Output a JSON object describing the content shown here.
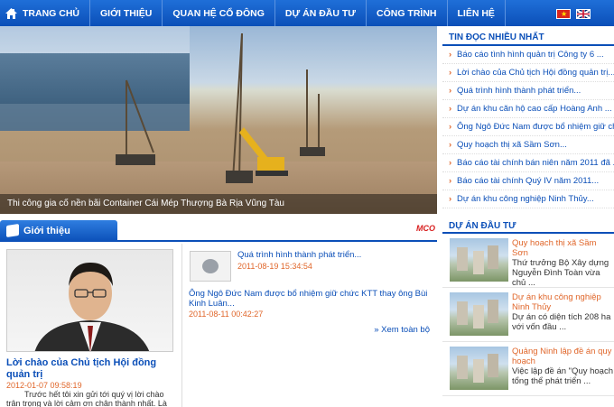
{
  "nav": {
    "items": [
      {
        "label": "TRANG CHỦ"
      },
      {
        "label": "GIỚI THIỆU"
      },
      {
        "label": "QUAN HỆ CỔ ĐÔNG"
      },
      {
        "label": "DỰ ÁN ĐẦU TƯ"
      },
      {
        "label": "CÔNG TRÌNH"
      },
      {
        "label": "LIÊN HỆ"
      }
    ],
    "languages": [
      "vi",
      "en"
    ]
  },
  "hero": {
    "caption": "Thi công gia cố nền bãi Container Cái Mép Thượng Bà Rịa Vũng Tàu"
  },
  "most_read": {
    "title": "TIN ĐỌC NHIỀU NHẤT",
    "items": [
      "Báo cáo tình hình quản trị Công ty 6 ...",
      "Lời chào của Chủ tịch Hội đồng quản trị...",
      "Quá trình hình thành phát triển...",
      "Dự án khu căn hộ cao cấp Hoàng Anh ...",
      "Ông Ngô Đức Nam được bổ nhiệm giữ chức ...",
      "Quy hoạch thị xã Sầm Sơn...",
      "Báo cáo tài chính bán niên năm 2011 đã ...",
      "Báo cáo tài chính Quý IV năm 2011...",
      "Dự án khu công nghiệp Ninh Thủy..."
    ]
  },
  "projects": {
    "title": "DỰ ÁN ĐẦU TƯ",
    "items": [
      {
        "title": "Quy hoạch thị xã Sầm Sơn",
        "desc": "Thứ trưởng Bộ Xây dựng Nguyễn Đình Toàn vừa chủ ..."
      },
      {
        "title": "Dự án khu công nghiệp Ninh Thủy",
        "desc": "Dự án có diện tích 208 ha với vốn đầu ..."
      },
      {
        "title": "Quảng Ninh lập đề án quy hoạch",
        "desc": "Việc lập đề án \"Quy hoạch tổng thể phát triển ..."
      }
    ]
  },
  "intro": {
    "tab_label": "Giới thiệu",
    "logo_text": "MCO",
    "title": "Lời chào của Chủ tịch Hội đồng quản trị",
    "date": "2012-01-07 09:58:19",
    "text": "Trước hết tôi xin gửi tới quý vị lời chào trân trọng và lời cảm ơn chân thành nhất. Là doanh"
  },
  "news": {
    "items": [
      {
        "title": "Quá trình hình thành phát triển...",
        "date": "2011-08-19 15:34:54"
      },
      {
        "title": "Ông Ngô Đức Nam được bổ nhiệm giữ chức KTT thay ông Bùi Kinh Luân...",
        "date": "2011-08-11 00:42:27"
      }
    ],
    "see_all": "Xem toàn bộ"
  }
}
